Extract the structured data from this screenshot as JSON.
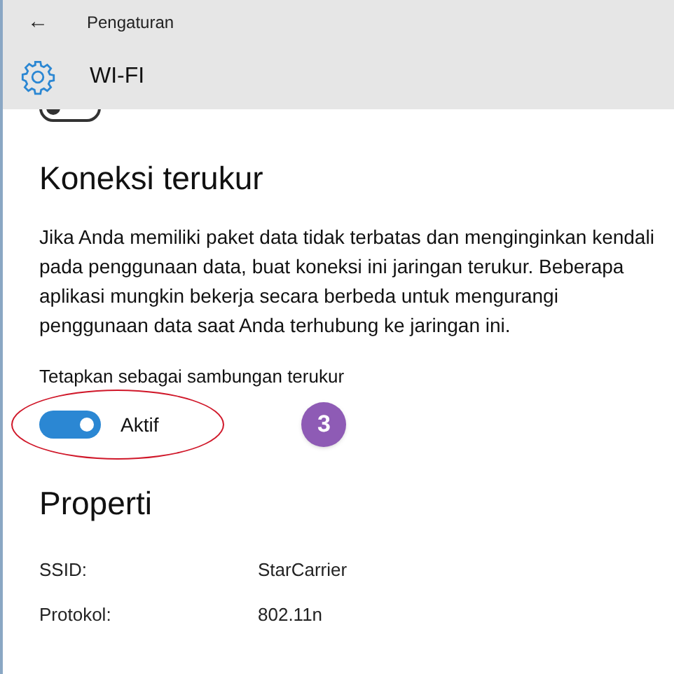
{
  "title_bar": {
    "back": "←",
    "title": "Pengaturan"
  },
  "header": {
    "title": "WI-FI"
  },
  "previous_toggle": {
    "on": false
  },
  "metered": {
    "heading": "Koneksi terukur",
    "description": "Jika Anda memiliki paket data tidak terbatas dan menginginkan kendali pada penggunaan data, buat koneksi ini jaringan terukur. Beberapa aplikasi mungkin bekerja secara berbeda untuk mengurangi penggunaan data saat Anda terhubung ke jaringan ini.",
    "toggle_label": "Tetapkan sebagai sambungan terukur",
    "on": true,
    "state_label": "Aktif",
    "step_badge": "3"
  },
  "properties": {
    "heading": "Properti",
    "rows": [
      {
        "label": "SSID:",
        "value": "StarCarrier"
      },
      {
        "label": "Protokol:",
        "value": "802.11n"
      }
    ]
  }
}
